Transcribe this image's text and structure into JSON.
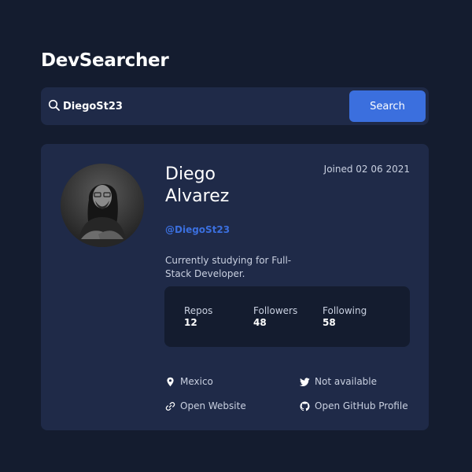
{
  "app": {
    "title": "DevSearcher"
  },
  "search": {
    "value": "DiegoSt23",
    "placeholder": "",
    "button_label": "Search"
  },
  "profile": {
    "name": "Diego Alvarez",
    "joined": "Joined 02 06 2021",
    "login": "@DiegoSt23",
    "bio": "Currently studying for Full-Stack Developer.",
    "stats": [
      {
        "label": "Repos",
        "value": "12"
      },
      {
        "label": "Followers",
        "value": "48"
      },
      {
        "label": "Following",
        "value": "58"
      }
    ],
    "links": {
      "location": {
        "text": "Mexico",
        "icon": "location-pin-icon"
      },
      "twitter": {
        "text": "Not available",
        "icon": "twitter-icon"
      },
      "website": {
        "text": "Open Website",
        "icon": "link-icon"
      },
      "github": {
        "text": "Open GitHub Profile",
        "icon": "github-icon"
      }
    }
  },
  "colors": {
    "background": "#141c2f",
    "card": "#1f2a48",
    "accent": "#3b6fde",
    "muted_text": "#c9d0e0"
  }
}
